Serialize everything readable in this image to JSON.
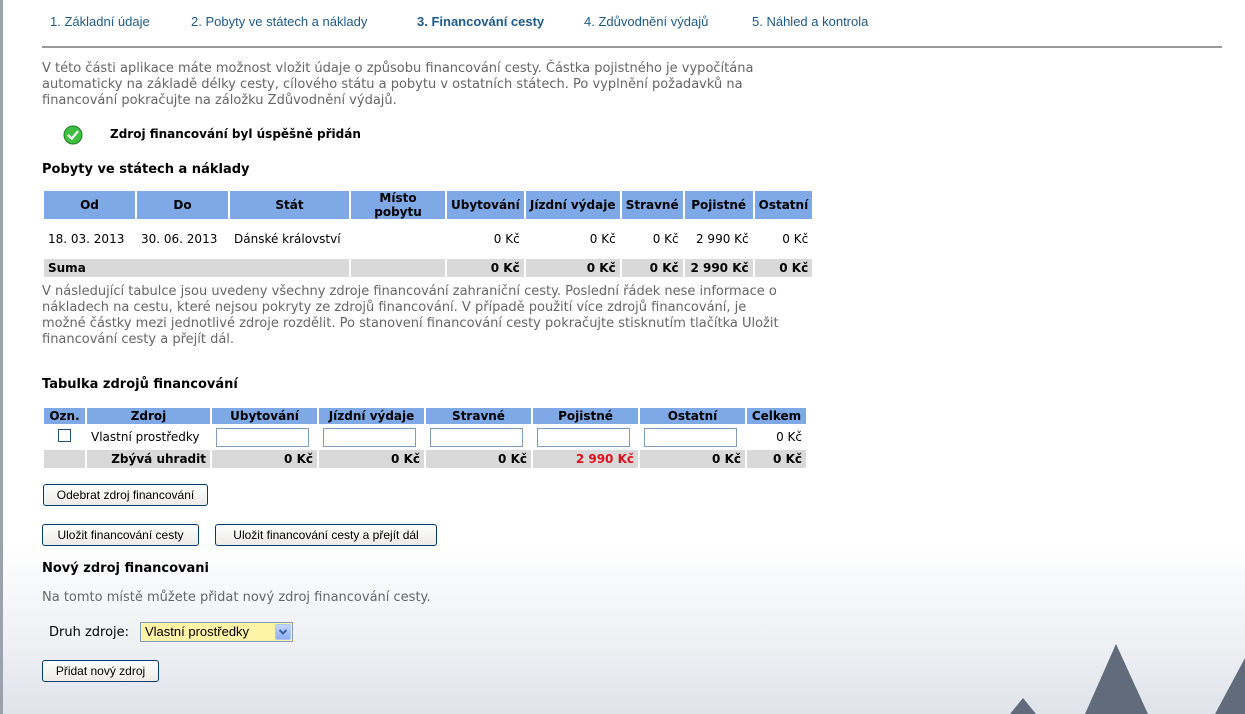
{
  "tabs": [
    {
      "label": "1. Základní údaje"
    },
    {
      "label": "2. Pobyty ve státech a náklady"
    },
    {
      "label": "3. Financování cesty"
    },
    {
      "label": "4. Zdůvodnění výdajů"
    },
    {
      "label": "5. Náhled a kontrola"
    }
  ],
  "intro": "V této části aplikace máte možnost vložit údaje o způsobu financování cesty. Částka pojistného je vypočítána automaticky na základě délky cesty, cílového státu a pobytu v ostatních státech. Po vyplnění požadavků na financování pokračujte na záložku Zdůvodnění výdajů.",
  "success_message": "Zdroj financování byl úspěšně přidán",
  "stays": {
    "title": "Pobyty ve státech a náklady",
    "headers": [
      "Od",
      "Do",
      "Stát",
      "Místo pobytu",
      "Ubytování",
      "Jízdní výdaje",
      "Stravné",
      "Pojistné",
      "Ostatní"
    ],
    "row": {
      "od": "18. 03. 2013",
      "do": "30. 06. 2013",
      "stat": "Dánské království",
      "misto": "",
      "ubytovani": "0 Kč",
      "jizdni": "0 Kč",
      "stravne": "0 Kč",
      "pojistne": "2 990 Kč",
      "ostatni": "0 Kč"
    },
    "sum": {
      "label": "Suma",
      "ubytovani": "0 Kč",
      "jizdni": "0 Kč",
      "stravne": "0 Kč",
      "pojistne": "2 990 Kč",
      "ostatni": "0 Kč"
    }
  },
  "explanation": "V následující tabulce jsou uvedeny všechny zdroje financování zahraniční cesty. Poslední řádek nese informace o nákladech na cestu, které nejsou pokryty ze zdrojů financování. V případě použití více zdrojů financování, je možné částky mezi jednotlivé zdroje rozdělit. Po stanovení financování cesty pokračujte stisknutím tlačítka Uložit financování cesty a přejít dál.",
  "funding": {
    "title": "Tabulka zdrojů financování",
    "headers": [
      "Ozn.",
      "Zdroj",
      "Ubytování",
      "Jízdní výdaje",
      "Stravné",
      "Pojistné",
      "Ostatní",
      "Celkem"
    ],
    "row": {
      "zdroj": "Vlastní prostředky",
      "celkem": "0 Kč"
    },
    "remaining": {
      "label": "Zbývá uhradit",
      "ubytovani": "0 Kč",
      "jizdni": "0 Kč",
      "stravne": "0 Kč",
      "pojistne": "2 990 Kč",
      "ostatni": "0 Kč",
      "celkem": "0 Kč"
    },
    "alert_color": "#e0101a"
  },
  "buttons": {
    "remove": "Odebrat zdroj financování",
    "save": "Uložit financování cesty",
    "save_next": "Uložit financování cesty a přejít dál",
    "add": "Přidat nový zdroj"
  },
  "new_source": {
    "title": "Nový zdroj financovani",
    "text": "Na tomto místě můžete přidat nový zdroj financování cesty.",
    "type_label": "Druh zdroje:",
    "type_value": "Vlastní prostředky"
  },
  "colors": {
    "header_bg": "#7fa8e6",
    "tab_link": "#1e5a8a",
    "sum_bg": "#d9d9d9",
    "select_bg": "#fff3a8"
  }
}
